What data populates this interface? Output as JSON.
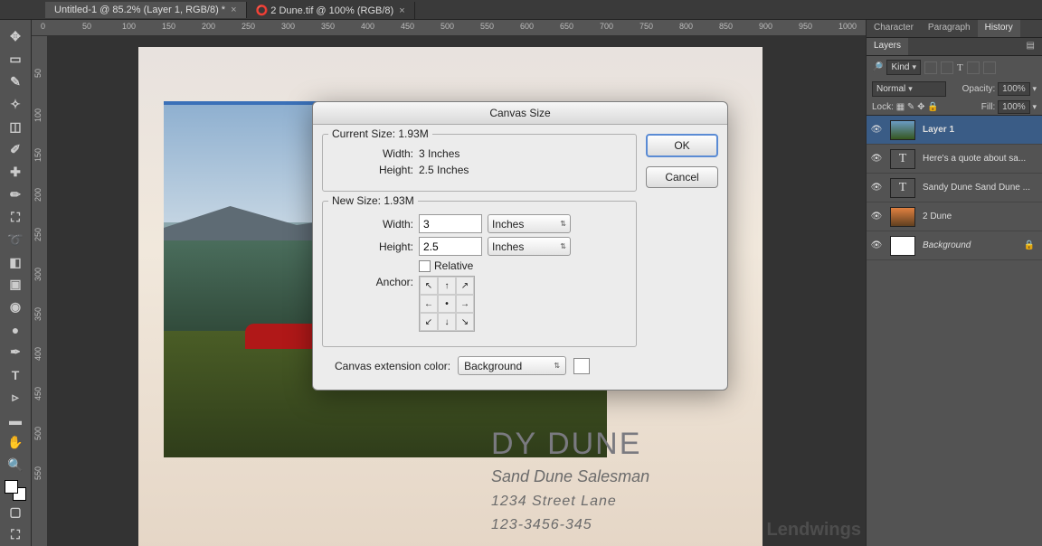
{
  "tabs": [
    {
      "label": "Untitled-1 @ 85.2% (Layer 1, RGB/8) *"
    },
    {
      "label": "2 Dune.tif @ 100% (RGB/8)"
    }
  ],
  "ruler_h": [
    "0",
    "50",
    "100",
    "150",
    "200",
    "250",
    "300",
    "350",
    "400",
    "450",
    "500",
    "550",
    "600",
    "650",
    "700",
    "750",
    "800",
    "850",
    "900",
    "950",
    "1000"
  ],
  "ruler_v": [
    "50",
    "100",
    "150",
    "200",
    "250",
    "300",
    "350",
    "400",
    "450",
    "500",
    "550"
  ],
  "panels": {
    "tabs_top": [
      "Character",
      "Paragraph",
      "History"
    ],
    "layers_label": "Layers",
    "kind_label": "Kind",
    "blend_mode": "Normal",
    "opacity_label": "Opacity:",
    "opacity_value": "100%",
    "lock_label": "Lock:",
    "fill_label": "Fill:",
    "fill_value": "100%",
    "layers": [
      {
        "name": "Layer 1",
        "type": "photo",
        "selected": true
      },
      {
        "name": "Here's a quote about sa...",
        "type": "T"
      },
      {
        "name": "Sandy Dune Sand Dune ...",
        "type": "T"
      },
      {
        "name": "2 Dune",
        "type": "photo2"
      },
      {
        "name": "Background",
        "type": "white",
        "locked": true,
        "italic": true
      }
    ]
  },
  "dialog": {
    "title": "Canvas Size",
    "current_legend": "Current Size: 1.93M",
    "cur_width_label": "Width:",
    "cur_width_value": "3 Inches",
    "cur_height_label": "Height:",
    "cur_height_value": "2.5 Inches",
    "new_legend": "New Size: 1.93M",
    "width_label": "Width:",
    "width_value": "3",
    "width_unit": "Inches",
    "height_label": "Height:",
    "height_value": "2.5",
    "height_unit": "Inches",
    "relative_label": "Relative",
    "anchor_label": "Anchor:",
    "ext_label": "Canvas extension color:",
    "ext_value": "Background",
    "ok": "OK",
    "cancel": "Cancel"
  },
  "card": {
    "title": "DY DUNE",
    "subtitle": "Sand Dune Salesman",
    "addr": "1234 Street Lane",
    "phone": "123-3456-345"
  },
  "watermark": "Lendwings"
}
